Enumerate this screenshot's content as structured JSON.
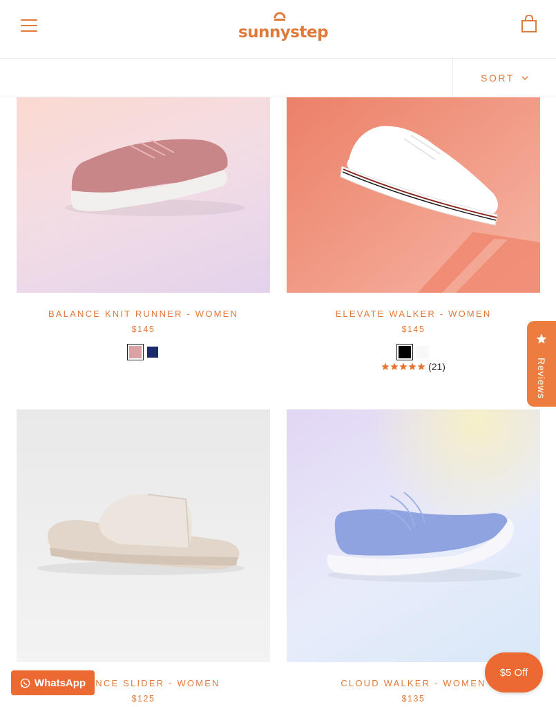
{
  "header": {
    "logo_text": "sunnystep",
    "menu_icon": "hamburger-menu-icon",
    "cart_icon": "shopping-bag-icon"
  },
  "sortbar": {
    "sort_label": "SORT"
  },
  "products": [
    {
      "title": "BALANCE KNIT RUNNER - WOMEN",
      "price": "$145",
      "swatches": [
        "#d9a3a4",
        "#1a2a6b"
      ],
      "selected_swatch": 0
    },
    {
      "title": "ELEVATE WALKER - WOMEN",
      "price": "$145",
      "swatches": [
        "#000000",
        "#f8f8f8"
      ],
      "selected_swatch": 0,
      "rating": {
        "stars": 5,
        "count": "(21)"
      }
    },
    {
      "title": "BALANCE SLIDER - WOMEN",
      "price": "$125"
    },
    {
      "title": "CLOUD WALKER - WOMEN",
      "price": "$135"
    }
  ],
  "floating": {
    "reviews_label": "Reviews",
    "whatsapp_label": "WhatsApp",
    "discount_label": "$5 Off"
  },
  "colors": {
    "accent": "#e07a3a",
    "button": "#ec6a32"
  }
}
